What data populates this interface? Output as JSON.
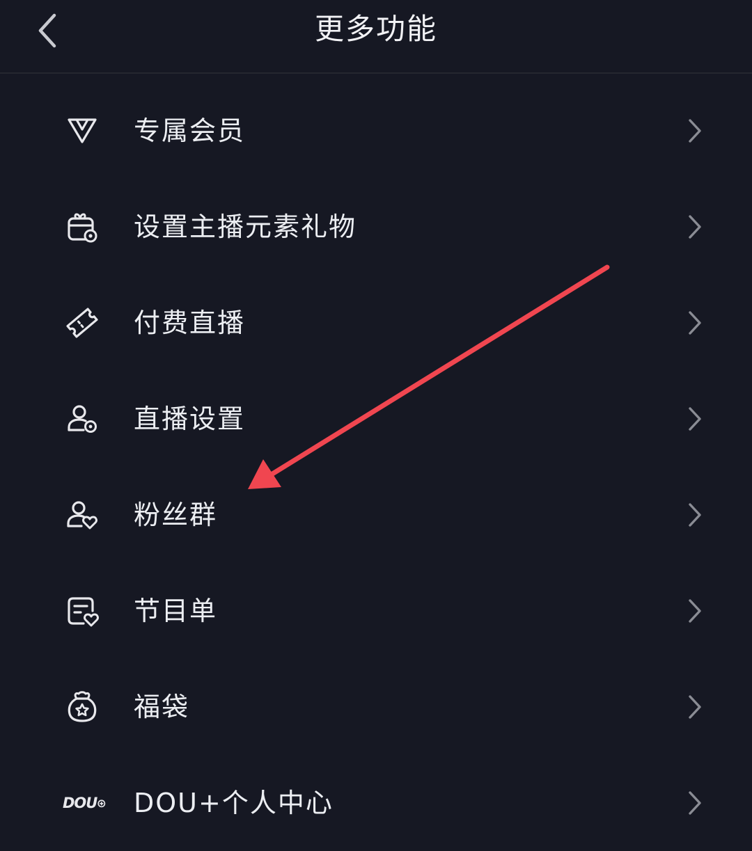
{
  "header": {
    "title": "更多功能",
    "back_icon": "chevron-left-icon"
  },
  "menu": {
    "items": [
      {
        "label": "专属会员",
        "icon": "v-badge-icon"
      },
      {
        "label": "设置主播元素礼物",
        "icon": "gift-settings-icon"
      },
      {
        "label": "付费直播",
        "icon": "ticket-icon"
      },
      {
        "label": "直播设置",
        "icon": "user-settings-icon"
      },
      {
        "label": "粉丝群",
        "icon": "user-heart-icon"
      },
      {
        "label": "节目单",
        "icon": "program-list-icon"
      },
      {
        "label": "福袋",
        "icon": "lucky-bag-icon"
      },
      {
        "label": "DOU+个人中心",
        "icon": "dou-plus-icon",
        "icon_text": "DOU"
      }
    ]
  },
  "colors": {
    "background": "#161823",
    "text": "#eceef2",
    "chevron": "#8a8c94",
    "annotation_arrow": "#f04650"
  }
}
